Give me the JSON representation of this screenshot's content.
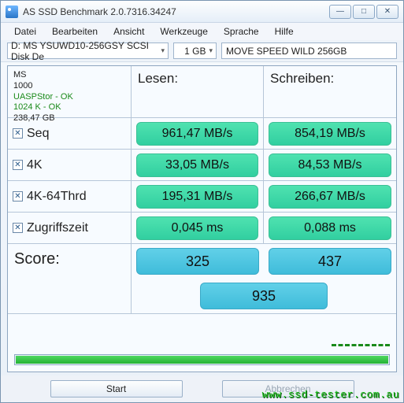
{
  "window": {
    "title": "AS SSD Benchmark 2.0.7316.34247"
  },
  "menu": {
    "file": "Datei",
    "edit": "Bearbeiten",
    "view": "Ansicht",
    "tools": "Werkzeuge",
    "language": "Sprache",
    "help": "Hilfe"
  },
  "toolbar": {
    "disk_selected": "D: MS YSUWD10-256GSY SCSI Disk De",
    "size_selected": "1 GB",
    "model": "MOVE SPEED WILD 256GB"
  },
  "diskinfo": {
    "name": "MS",
    "iops": "1000",
    "driver": "UASPStor - OK",
    "align": "1024 K - OK",
    "capacity": "238,47 GB"
  },
  "headers": {
    "read": "Lesen:",
    "write": "Schreiben:"
  },
  "rows": {
    "seq": {
      "label": "Seq",
      "read": "961,47 MB/s",
      "write": "854,19 MB/s"
    },
    "k4": {
      "label": "4K",
      "read": "33,05 MB/s",
      "write": "84,53 MB/s"
    },
    "k4_64": {
      "label": "4K-64Thrd",
      "read": "195,31 MB/s",
      "write": "266,67 MB/s"
    },
    "access": {
      "label": "Zugriffszeit",
      "read": "0,045 ms",
      "write": "0,088 ms"
    }
  },
  "score": {
    "label": "Score:",
    "read": "325",
    "write": "437",
    "total": "935"
  },
  "buttons": {
    "start": "Start",
    "abort": "Abbrechen"
  },
  "watermark": "www.ssd-tester.com.au",
  "icons": {
    "min": "—",
    "max": "□",
    "close": "✕",
    "caret": "▾",
    "check": "✕"
  }
}
